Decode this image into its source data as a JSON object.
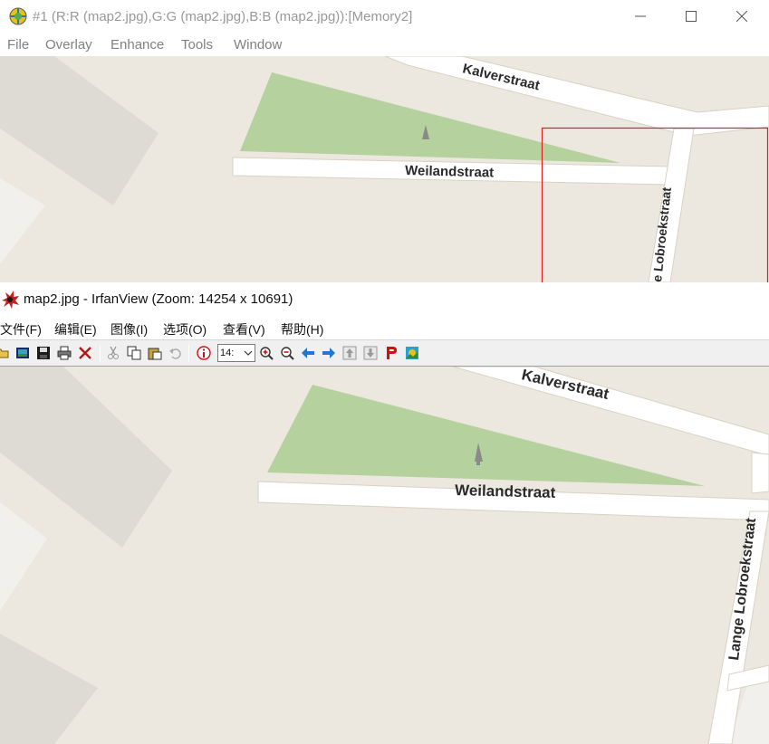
{
  "window1": {
    "title": "#1 (R:R (map2.jpg),G:G (map2.jpg),B:B (map2.jpg)):[Memory2]",
    "menu": [
      "File",
      "Overlay",
      "Enhance",
      "Tools",
      "Window"
    ],
    "controls": {
      "minimize_icon": "minimize-icon",
      "maximize_icon": "maximize-icon",
      "close_icon": "close-icon"
    }
  },
  "window2": {
    "title": "map2.jpg - IrfanView (Zoom: 14254 x 10691)",
    "menu": [
      "文件(F)",
      "编辑(E)",
      "图像(I)",
      "选项(O)",
      "查看(V)",
      "帮助(H)"
    ],
    "zoom_value": "14:",
    "toolbar_icons": [
      "open-icon",
      "thumbnails-icon",
      "save-icon",
      "print-icon",
      "delete-icon",
      "cut-icon",
      "copy-icon",
      "paste-icon",
      "undo-icon",
      "info-icon",
      "zoom-in-icon",
      "zoom-out-icon",
      "previous-icon",
      "next-icon",
      "first-icon",
      "last-icon",
      "paint-icon",
      "about-icon"
    ]
  },
  "map": {
    "streets": [
      "Kalverstraat",
      "Weilandstraat",
      "Lange Lobroekstraat"
    ],
    "top_view_lobroek_label": "e Lobroekstraat",
    "colors": {
      "background": "#ece8df",
      "park": "#b5d29e",
      "road": "#ffffff",
      "road_edge": "#d9d2c3",
      "building": "#dedbd5",
      "selection": "#e02020"
    }
  }
}
